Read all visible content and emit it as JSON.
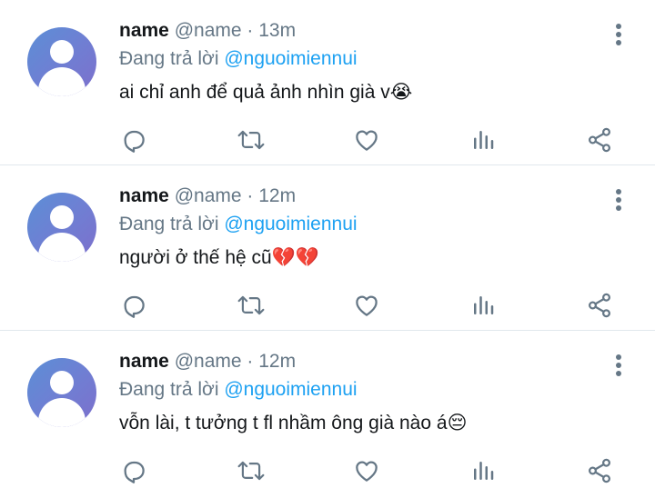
{
  "tweets": [
    {
      "name": "name",
      "handle": "@name",
      "separator": "·",
      "time": "13m",
      "replying_prefix": "Đang trả lời",
      "replying_to": "@nguoimiennui",
      "text": "ai chỉ anh để quả ảnh nhìn già v",
      "emoji": "😭"
    },
    {
      "name": "name",
      "handle": "@name",
      "separator": "·",
      "time": "12m",
      "replying_prefix": "Đang trả lời",
      "replying_to": "@nguoimiennui",
      "text": "người ở thế hệ cũ",
      "emoji": "💔💔"
    },
    {
      "name": "name",
      "handle": "@name",
      "separator": "·",
      "time": "12m",
      "replying_prefix": "Đang trả lời",
      "replying_to": "@nguoimiennui",
      "text": "vỗn lài, t tưởng t fl nhầm ông già nào á",
      "emoji": "😔"
    }
  ],
  "icons": {
    "more": "more-vertical-icon",
    "reply": "reply-icon",
    "retweet": "retweet-icon",
    "like": "heart-icon",
    "stats": "stats-icon",
    "share": "share-icon"
  },
  "colors": {
    "text": "#14171a",
    "secondary": "#657786",
    "mention": "#1da1f2",
    "icon": "#657786",
    "divider": "#e1e8ed"
  }
}
